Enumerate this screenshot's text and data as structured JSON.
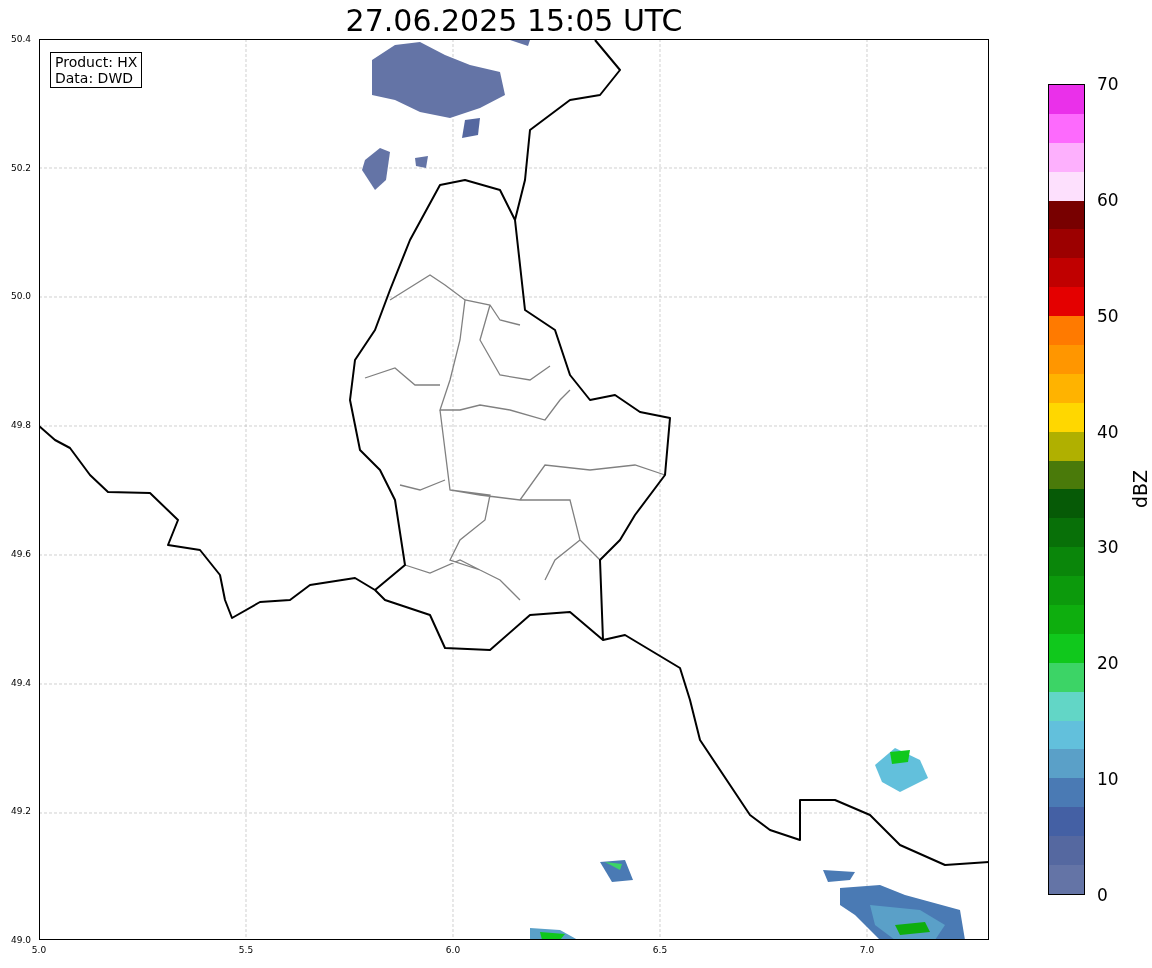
{
  "title": "27.06.2025 15:05 UTC",
  "info_box": {
    "lines": [
      "Product: HX",
      "Data: DWD"
    ]
  },
  "map": {
    "x_ticks": [
      "5.0",
      "5.5",
      "6.0",
      "6.5",
      "7.0"
    ],
    "y_ticks": [
      "50.4",
      "50.2",
      "50.0",
      "49.8",
      "49.6",
      "49.4",
      "49.2",
      "49.0"
    ]
  },
  "colorbar": {
    "label": "dBZ",
    "ticks": [
      "70",
      "60",
      "50",
      "40",
      "30",
      "20",
      "10",
      "0"
    ],
    "bins": [
      {
        "color": "#ea30ea"
      },
      {
        "color": "#fd6afd"
      },
      {
        "color": "#fdb0fd"
      },
      {
        "color": "#fde0fd"
      },
      {
        "color": "#780000"
      },
      {
        "color": "#9c0000"
      },
      {
        "color": "#c00000"
      },
      {
        "color": "#e40000"
      },
      {
        "color": "#ff7a00"
      },
      {
        "color": "#ff9600"
      },
      {
        "color": "#ffb300"
      },
      {
        "color": "#ffd700"
      },
      {
        "color": "#b0b000"
      },
      {
        "color": "#4a7a0a"
      },
      {
        "color": "#065a06"
      },
      {
        "color": "#087008"
      },
      {
        "color": "#0a860a"
      },
      {
        "color": "#0c9a0c"
      },
      {
        "color": "#0eae0e"
      },
      {
        "color": "#10c81c"
      },
      {
        "color": "#3cd466"
      },
      {
        "color": "#62d6c6"
      },
      {
        "color": "#62c0dc"
      },
      {
        "color": "#5aa0c8"
      },
      {
        "color": "#4a7ab4"
      },
      {
        "color": "#4460a4"
      },
      {
        "color": "#5568a0"
      },
      {
        "color": "#6474a6"
      }
    ]
  }
}
